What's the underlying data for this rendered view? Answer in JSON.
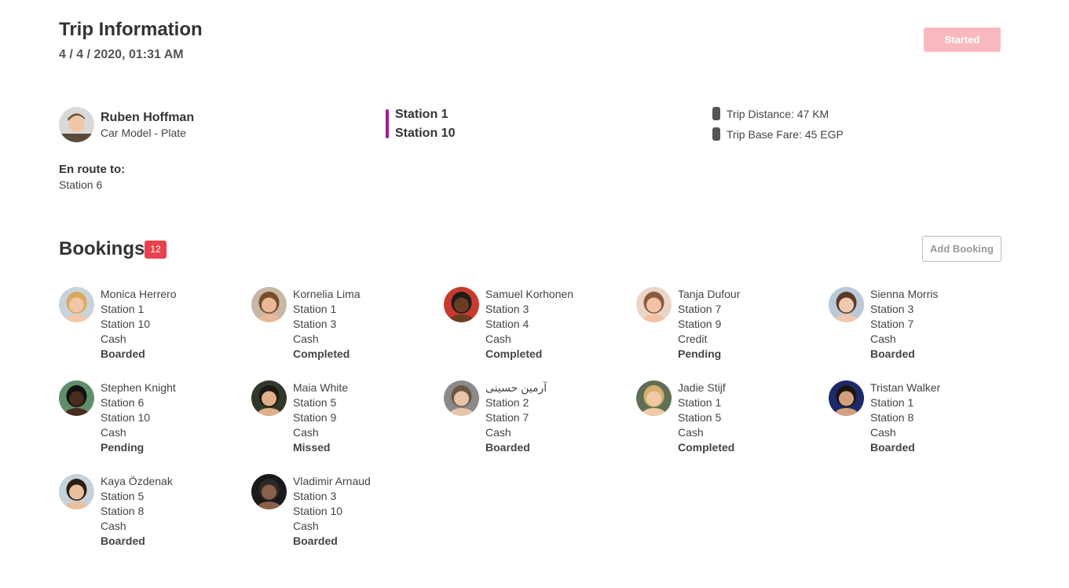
{
  "trip": {
    "title": "Trip Information",
    "date": "4 / 4 / 2020, 01:31 AM",
    "status_button": "Started"
  },
  "driver": {
    "name": "Ruben Hoffman",
    "car": "Car Model - Plate",
    "enroute_label": "En route to:",
    "enroute_station": "Station 6"
  },
  "route": {
    "from": "Station 1",
    "to": "Station 10",
    "accent": "#9b1e8c"
  },
  "stats": {
    "distance": "Trip Distance: 47 KM",
    "fare": "Trip Base Fare: 45 EGP"
  },
  "bookings": {
    "title": "Bookings",
    "count": "12",
    "add_button": "Add Booking",
    "items": [
      {
        "name": "Monica Herrero",
        "from": "Station 1",
        "to": "Station 10",
        "payment": "Cash",
        "status": "Boarded",
        "status_type": "boarded",
        "skin": "#f0c8a8",
        "hair": "#d9a85a",
        "bg": "#c9d3dc"
      },
      {
        "name": "Kornelia Lima",
        "from": "Station 1",
        "to": "Station 3",
        "payment": "Cash",
        "status": "Completed",
        "status_type": "completed",
        "skin": "#e9b896",
        "hair": "#7a4a2a",
        "bg": "#c7b7a5"
      },
      {
        "name": "Samuel Korhonen",
        "from": "Station 3",
        "to": "Station 4",
        "payment": "Cash",
        "status": "Completed",
        "status_type": "completed",
        "skin": "#6b3d22",
        "hair": "#1d1d1d",
        "bg": "#c83a2d"
      },
      {
        "name": "Tanja Dufour",
        "from": "Station 7",
        "to": "Station 9",
        "payment": "Credit",
        "status": "Pending",
        "status_type": "pending",
        "skin": "#f1c2a4",
        "hair": "#8a5a3c",
        "bg": "#e9d6c6"
      },
      {
        "name": "Sienna Morris",
        "from": "Station 3",
        "to": "Station 7",
        "payment": "Cash",
        "status": "Boarded",
        "status_type": "boarded",
        "skin": "#efc9b0",
        "hair": "#5b3a28",
        "bg": "#b9c9d9"
      },
      {
        "name": "Stephen Knight",
        "from": "Station 6",
        "to": "Station 10",
        "payment": "Cash",
        "status": "Pending",
        "status_type": "pending",
        "skin": "#4a2c1c",
        "hair": "#111111",
        "bg": "#5f8f6a"
      },
      {
        "name": "Maia White",
        "from": "Station 5",
        "to": "Station 9",
        "payment": "Cash",
        "status": "Missed",
        "status_type": "missed",
        "skin": "#e0b08a",
        "hair": "#1f1713",
        "bg": "#2f3a2a"
      },
      {
        "name": "آرمین حسینی",
        "from": "Station 2",
        "to": "Station 7",
        "payment": "Cash",
        "status": "Boarded",
        "status_type": "boarded",
        "skin": "#e8c4aa",
        "hair": "#6b5744",
        "bg": "#8a8a8a"
      },
      {
        "name": "Jadie Stijf",
        "from": "Station 1",
        "to": "Station 5",
        "payment": "Cash",
        "status": "Completed",
        "status_type": "completed",
        "skin": "#f0c9a6",
        "hair": "#d7b06a",
        "bg": "#5f6f56"
      },
      {
        "name": "Tristan Walker",
        "from": "Station 1",
        "to": "Station 8",
        "payment": "Cash",
        "status": "Boarded",
        "status_type": "boarded",
        "skin": "#d2a080",
        "hair": "#1c1410",
        "bg": "#1c2a6a"
      },
      {
        "name": "Kaya Özdenak",
        "from": "Station 5",
        "to": "Station 8",
        "payment": "Cash",
        "status": "Boarded",
        "status_type": "boarded",
        "skin": "#eabf9c",
        "hair": "#2a1e16",
        "bg": "#c5d2da"
      },
      {
        "name": "Vladimir Arnaud",
        "from": "Station 3",
        "to": "Station 10",
        "payment": "Cash",
        "status": "Boarded",
        "status_type": "boarded",
        "skin": "#8a6048",
        "hair": "#2a2a2a",
        "bg": "#1a1a1a"
      }
    ]
  }
}
